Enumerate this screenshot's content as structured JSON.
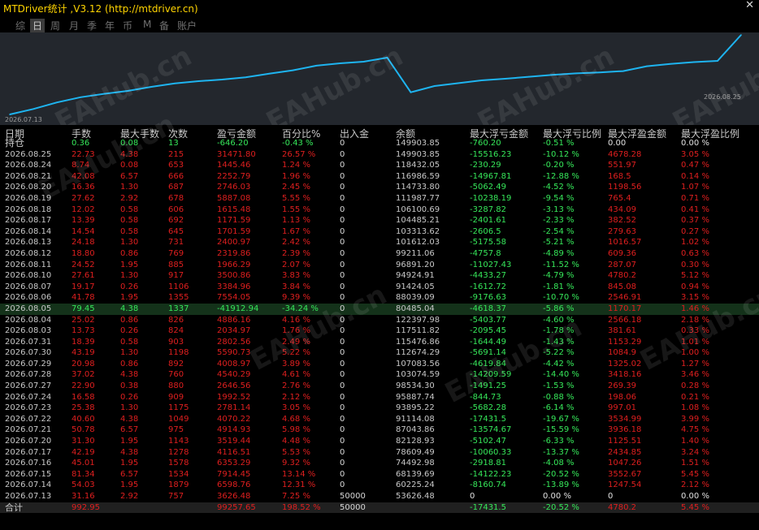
{
  "window": {
    "title": "MTDriver统计 ,V3.12 (http://mtdriver.cn)",
    "close_label": "✕"
  },
  "tabs": [
    "综",
    "日",
    "周",
    "月",
    "季",
    "年",
    "币",
    "M",
    "备",
    "账户"
  ],
  "active_tab": "日",
  "chart": {
    "x_start_label": "2026.07.13",
    "x_end_label": "2026.08.25",
    "line_color": "#1eb4f0",
    "watermark": "EAHub.cn"
  },
  "chart_data": {
    "type": "line",
    "x": [
      "2026.07.13",
      "2026.07.14",
      "2026.07.15",
      "2026.07.16",
      "2026.07.17",
      "2026.07.20",
      "2026.07.21",
      "2026.07.22",
      "2026.07.23",
      "2026.07.24",
      "2026.07.27",
      "2026.07.28",
      "2026.07.29",
      "2026.07.30",
      "2026.07.31",
      "2026.08.03",
      "2026.08.04",
      "2026.08.05",
      "2026.08.06",
      "2026.08.07",
      "2026.08.10",
      "2026.08.11",
      "2026.08.12",
      "2026.08.13",
      "2026.08.14",
      "2026.08.17",
      "2026.08.18",
      "2026.08.19",
      "2026.08.20",
      "2026.08.21",
      "2026.08.24",
      "2026.08.25"
    ],
    "series": [
      {
        "values": [
          53626.48,
          60225.24,
          68139.69,
          74492.98,
          78609.49,
          82128.93,
          87043.86,
          91114.08,
          93895.22,
          95887.74,
          98534.3,
          103074.59,
          107083.56,
          112674.29,
          115476.86,
          117511.82,
          122397.98,
          80485.04,
          88039.09,
          91424.05,
          94924.91,
          96891.2,
          99211.06,
          101612.03,
          103313.62,
          104485.21,
          106100.69,
          111987.77,
          114733.8,
          116986.59,
          118432.05,
          149903.85
        ]
      }
    ]
  },
  "columns": [
    "日期",
    "手数",
    "最大手数",
    "次数",
    "盈亏金额",
    "百分比%",
    "出入金",
    "余额",
    "最大浮亏金额",
    "最大浮亏比例",
    "最大浮盈金额",
    "最大浮盈比例"
  ],
  "holding": {
    "date": "持仓",
    "lots": "0.36",
    "max_lots": "0.08",
    "count": "13",
    "pnl": "-646.20",
    "pct": "-0.43 %",
    "flow": "0",
    "balance": "149903.85",
    "max_dd_amt": "-760.20",
    "max_dd_pct": "-0.51 %",
    "max_fp_amt": "0.00",
    "max_fp_pct": "0.00 %"
  },
  "rows": [
    {
      "date": "2026.08.25",
      "lots": "22.73",
      "max_lots": "4.38",
      "count": "215",
      "pnl": "31471.80",
      "pct": "26.57 %",
      "flow": "0",
      "balance": "149903.85",
      "max_dd_amt": "-15516.23",
      "max_dd_pct": "-10.12 %",
      "max_fp_amt": "4678.28",
      "max_fp_pct": "3.05 %"
    },
    {
      "date": "2026.08.24",
      "lots": "8.74",
      "max_lots": "0.08",
      "count": "653",
      "pnl": "1445.46",
      "pct": "1.24 %",
      "flow": "0",
      "balance": "118432.05",
      "max_dd_amt": "-230.29",
      "max_dd_pct": "-0.20 %",
      "max_fp_amt": "551.97",
      "max_fp_pct": "0.47 %"
    },
    {
      "date": "2026.08.21",
      "lots": "42.08",
      "max_lots": "6.57",
      "count": "666",
      "pnl": "2252.79",
      "pct": "1.96 %",
      "flow": "0",
      "balance": "116986.59",
      "max_dd_amt": "-14967.81",
      "max_dd_pct": "-12.88 %",
      "max_fp_amt": "168.5",
      "max_fp_pct": "0.14 %"
    },
    {
      "date": "2026.08.20",
      "lots": "16.36",
      "max_lots": "1.30",
      "count": "687",
      "pnl": "2746.03",
      "pct": "2.45 %",
      "flow": "0",
      "balance": "114733.80",
      "max_dd_amt": "-5062.49",
      "max_dd_pct": "-4.52 %",
      "max_fp_amt": "1198.56",
      "max_fp_pct": "1.07 %"
    },
    {
      "date": "2026.08.19",
      "lots": "27.62",
      "max_lots": "2.92",
      "count": "678",
      "pnl": "5887.08",
      "pct": "5.55 %",
      "flow": "0",
      "balance": "111987.77",
      "max_dd_amt": "-10238.19",
      "max_dd_pct": "-9.54 %",
      "max_fp_amt": "765.4",
      "max_fp_pct": "0.71 %"
    },
    {
      "date": "2026.08.18",
      "lots": "12.02",
      "max_lots": "0.58",
      "count": "606",
      "pnl": "1615.48",
      "pct": "1.55 %",
      "flow": "0",
      "balance": "106100.69",
      "max_dd_amt": "-3287.82",
      "max_dd_pct": "-3.13 %",
      "max_fp_amt": "434.09",
      "max_fp_pct": "0.41 %"
    },
    {
      "date": "2026.08.17",
      "lots": "13.39",
      "max_lots": "0.58",
      "count": "692",
      "pnl": "1171.59",
      "pct": "1.13 %",
      "flow": "0",
      "balance": "104485.21",
      "max_dd_amt": "-2401.61",
      "max_dd_pct": "-2.33 %",
      "max_fp_amt": "382.52",
      "max_fp_pct": "0.37 %"
    },
    {
      "date": "2026.08.14",
      "lots": "14.54",
      "max_lots": "0.58",
      "count": "645",
      "pnl": "1701.59",
      "pct": "1.67 %",
      "flow": "0",
      "balance": "103313.62",
      "max_dd_amt": "-2606.5",
      "max_dd_pct": "-2.54 %",
      "max_fp_amt": "279.63",
      "max_fp_pct": "0.27 %"
    },
    {
      "date": "2026.08.13",
      "lots": "24.18",
      "max_lots": "1.30",
      "count": "731",
      "pnl": "2400.97",
      "pct": "2.42 %",
      "flow": "0",
      "balance": "101612.03",
      "max_dd_amt": "-5175.58",
      "max_dd_pct": "-5.21 %",
      "max_fp_amt": "1016.57",
      "max_fp_pct": "1.02 %"
    },
    {
      "date": "2026.08.12",
      "lots": "18.80",
      "max_lots": "0.86",
      "count": "769",
      "pnl": "2319.86",
      "pct": "2.39 %",
      "flow": "0",
      "balance": "99211.06",
      "max_dd_amt": "-4757.8",
      "max_dd_pct": "-4.89 %",
      "max_fp_amt": "609.36",
      "max_fp_pct": "0.63 %"
    },
    {
      "date": "2026.08.11",
      "lots": "24.52",
      "max_lots": "1.95",
      "count": "885",
      "pnl": "1966.29",
      "pct": "2.07 %",
      "flow": "0",
      "balance": "96891.20",
      "max_dd_amt": "-11027.43",
      "max_dd_pct": "-11.52 %",
      "max_fp_amt": "287.07",
      "max_fp_pct": "0.30 %"
    },
    {
      "date": "2026.08.10",
      "lots": "27.61",
      "max_lots": "1.30",
      "count": "917",
      "pnl": "3500.86",
      "pct": "3.83 %",
      "flow": "0",
      "balance": "94924.91",
      "max_dd_amt": "-4433.27",
      "max_dd_pct": "-4.79 %",
      "max_fp_amt": "4780.2",
      "max_fp_pct": "5.12 %"
    },
    {
      "date": "2026.08.07",
      "lots": "19.17",
      "max_lots": "0.26",
      "count": "1106",
      "pnl": "3384.96",
      "pct": "3.84 %",
      "flow": "0",
      "balance": "91424.05",
      "max_dd_amt": "-1612.72",
      "max_dd_pct": "-1.81 %",
      "max_fp_amt": "845.08",
      "max_fp_pct": "0.94 %"
    },
    {
      "date": "2026.08.06",
      "lots": "41.78",
      "max_lots": "1.95",
      "count": "1355",
      "pnl": "7554.05",
      "pct": "9.39 %",
      "flow": "0",
      "balance": "88039.09",
      "max_dd_amt": "-9176.63",
      "max_dd_pct": "-10.70 %",
      "max_fp_amt": "2546.91",
      "max_fp_pct": "3.15 %"
    },
    {
      "date": "2026.08.05",
      "lots": "79.45",
      "max_lots": "4.38",
      "count": "1337",
      "pnl": "-41912.94",
      "pct": "-34.24 %",
      "flow": "0",
      "balance": "80485.04",
      "max_dd_amt": "-4618.37",
      "max_dd_pct": "-5.86 %",
      "max_fp_amt": "1170.17",
      "max_fp_pct": "1.46 %",
      "selected": true
    },
    {
      "date": "2026.08.04",
      "lots": "25.02",
      "max_lots": "0.86",
      "count": "826",
      "pnl": "4886.16",
      "pct": "4.16 %",
      "flow": "0",
      "balance": "122397.98",
      "max_dd_amt": "-5403.77",
      "max_dd_pct": "-4.60 %",
      "max_fp_amt": "2566.18",
      "max_fp_pct": "2.18 %"
    },
    {
      "date": "2026.08.03",
      "lots": "13.73",
      "max_lots": "0.26",
      "count": "824",
      "pnl": "2034.97",
      "pct": "1.76 %",
      "flow": "0",
      "balance": "117511.82",
      "max_dd_amt": "-2095.45",
      "max_dd_pct": "-1.78 %",
      "max_fp_amt": "381.61",
      "max_fp_pct": "0.33 %"
    },
    {
      "date": "2026.07.31",
      "lots": "18.39",
      "max_lots": "0.58",
      "count": "903",
      "pnl": "2802.56",
      "pct": "2.49 %",
      "flow": "0",
      "balance": "115476.86",
      "max_dd_amt": "-1644.49",
      "max_dd_pct": "-1.43 %",
      "max_fp_amt": "1153.29",
      "max_fp_pct": "1.01 %"
    },
    {
      "date": "2026.07.30",
      "lots": "43.19",
      "max_lots": "1.30",
      "count": "1198",
      "pnl": "5590.73",
      "pct": "5.22 %",
      "flow": "0",
      "balance": "112674.29",
      "max_dd_amt": "-5691.14",
      "max_dd_pct": "-5.22 %",
      "max_fp_amt": "1084.9",
      "max_fp_pct": "1.00 %"
    },
    {
      "date": "2026.07.29",
      "lots": "20.98",
      "max_lots": "0.86",
      "count": "892",
      "pnl": "4008.97",
      "pct": "3.89 %",
      "flow": "0",
      "balance": "107083.56",
      "max_dd_amt": "-4619.84",
      "max_dd_pct": "-4.42 %",
      "max_fp_amt": "1325.02",
      "max_fp_pct": "1.27 %"
    },
    {
      "date": "2026.07.28",
      "lots": "37.02",
      "max_lots": "4.38",
      "count": "760",
      "pnl": "4540.29",
      "pct": "4.61 %",
      "flow": "0",
      "balance": "103074.59",
      "max_dd_amt": "-14209.59",
      "max_dd_pct": "-14.40 %",
      "max_fp_amt": "3418.16",
      "max_fp_pct": "3.46 %"
    },
    {
      "date": "2026.07.27",
      "lots": "22.90",
      "max_lots": "0.38",
      "count": "880",
      "pnl": "2646.56",
      "pct": "2.76 %",
      "flow": "0",
      "balance": "98534.30",
      "max_dd_amt": "-1491.25",
      "max_dd_pct": "-1.53 %",
      "max_fp_amt": "269.39",
      "max_fp_pct": "0.28 %"
    },
    {
      "date": "2026.07.24",
      "lots": "16.58",
      "max_lots": "0.26",
      "count": "909",
      "pnl": "1992.52",
      "pct": "2.12 %",
      "flow": "0",
      "balance": "95887.74",
      "max_dd_amt": "-844.73",
      "max_dd_pct": "-0.88 %",
      "max_fp_amt": "198.06",
      "max_fp_pct": "0.21 %"
    },
    {
      "date": "2026.07.23",
      "lots": "25.38",
      "max_lots": "1.30",
      "count": "1175",
      "pnl": "2781.14",
      "pct": "3.05 %",
      "flow": "0",
      "balance": "93895.22",
      "max_dd_amt": "-5682.28",
      "max_dd_pct": "-6.14 %",
      "max_fp_amt": "997.01",
      "max_fp_pct": "1.08 %"
    },
    {
      "date": "2026.07.22",
      "lots": "40.60",
      "max_lots": "4.38",
      "count": "1049",
      "pnl": "4070.22",
      "pct": "4.68 %",
      "flow": "0",
      "balance": "91114.08",
      "max_dd_amt": "-17431.5",
      "max_dd_pct": "-19.67 %",
      "max_fp_amt": "3534.99",
      "max_fp_pct": "3.99 %"
    },
    {
      "date": "2026.07.21",
      "lots": "50.78",
      "max_lots": "6.57",
      "count": "975",
      "pnl": "4914.93",
      "pct": "5.98 %",
      "flow": "0",
      "balance": "87043.86",
      "max_dd_amt": "-13574.67",
      "max_dd_pct": "-15.59 %",
      "max_fp_amt": "3936.18",
      "max_fp_pct": "4.75 %"
    },
    {
      "date": "2026.07.20",
      "lots": "31.30",
      "max_lots": "1.95",
      "count": "1143",
      "pnl": "3519.44",
      "pct": "4.48 %",
      "flow": "0",
      "balance": "82128.93",
      "max_dd_amt": "-5102.47",
      "max_dd_pct": "-6.33 %",
      "max_fp_amt": "1125.51",
      "max_fp_pct": "1.40 %"
    },
    {
      "date": "2026.07.17",
      "lots": "42.19",
      "max_lots": "4.38",
      "count": "1278",
      "pnl": "4116.51",
      "pct": "5.53 %",
      "flow": "0",
      "balance": "78609.49",
      "max_dd_amt": "-10060.33",
      "max_dd_pct": "-13.37 %",
      "max_fp_amt": "2434.85",
      "max_fp_pct": "3.24 %"
    },
    {
      "date": "2026.07.16",
      "lots": "45.01",
      "max_lots": "1.95",
      "count": "1578",
      "pnl": "6353.29",
      "pct": "9.32 %",
      "flow": "0",
      "balance": "74492.98",
      "max_dd_amt": "-2918.81",
      "max_dd_pct": "-4.08 %",
      "max_fp_amt": "1047.26",
      "max_fp_pct": "1.51 %"
    },
    {
      "date": "2026.07.15",
      "lots": "81.34",
      "max_lots": "6.57",
      "count": "1534",
      "pnl": "7914.45",
      "pct": "13.14 %",
      "flow": "0",
      "balance": "68139.69",
      "max_dd_amt": "-14122.23",
      "max_dd_pct": "-20.52 %",
      "max_fp_amt": "3552.67",
      "max_fp_pct": "5.45 %"
    },
    {
      "date": "2026.07.14",
      "lots": "54.03",
      "max_lots": "1.95",
      "count": "1879",
      "pnl": "6598.76",
      "pct": "12.31 %",
      "flow": "0",
      "balance": "60225.24",
      "max_dd_amt": "-8160.74",
      "max_dd_pct": "-13.89 %",
      "max_fp_amt": "1247.54",
      "max_fp_pct": "2.12 %"
    },
    {
      "date": "2026.07.13",
      "lots": "31.16",
      "max_lots": "2.92",
      "count": "757",
      "pnl": "3626.48",
      "pct": "7.25 %",
      "flow": "50000",
      "balance": "53626.48",
      "max_dd_amt": "0",
      "max_dd_pct": "0.00 %",
      "max_fp_amt": "0",
      "max_fp_pct": "0.00 %"
    }
  ],
  "total": {
    "date": "合计",
    "lots": "992.95",
    "max_lots": "",
    "count": "",
    "pnl": "99257.65",
    "pct": "198.52 %",
    "flow": "50000",
    "balance": "",
    "max_dd_amt": "-17431.5",
    "max_dd_pct": "-20.52 %",
    "max_fp_amt": "4780.2",
    "max_fp_pct": "5.45 %"
  },
  "colors": {
    "positive": "#e01f1f",
    "negative": "#36e85a",
    "neutral": "#e0e0e0",
    "chart_bg": "#23272d",
    "selected_row": "#14321a"
  }
}
